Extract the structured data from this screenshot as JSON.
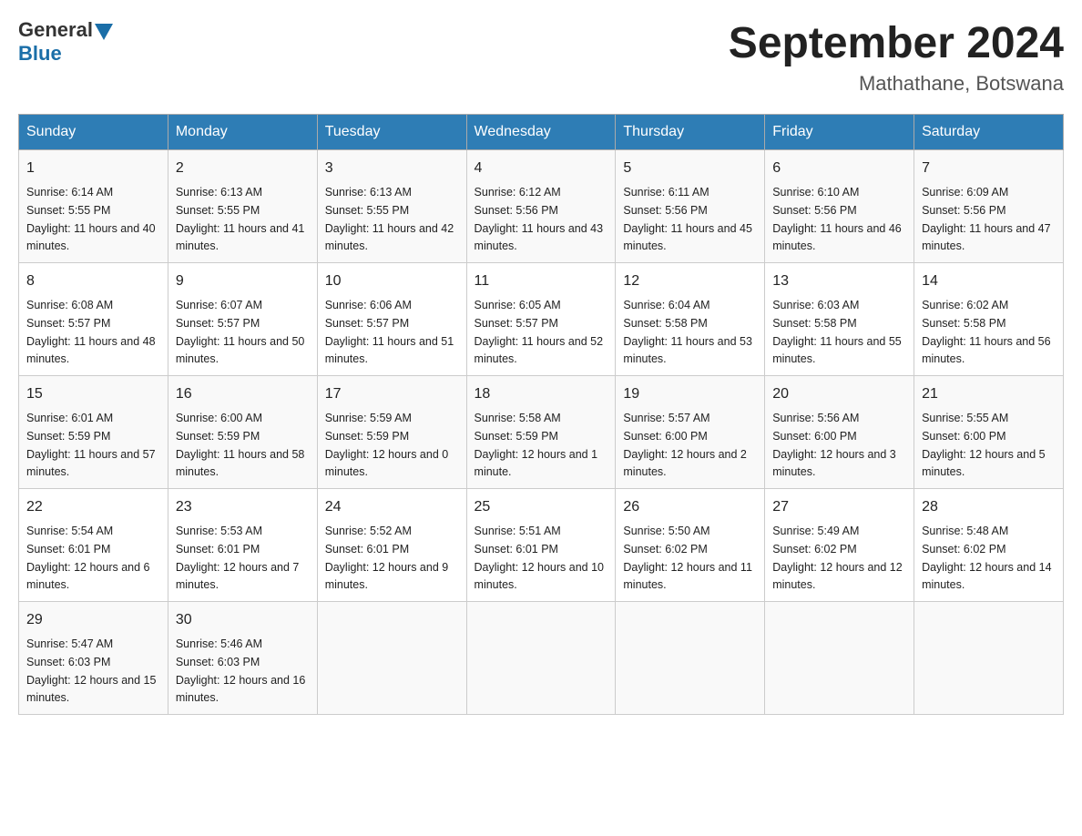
{
  "header": {
    "logo_general": "General",
    "logo_blue": "Blue",
    "month_title": "September 2024",
    "location": "Mathathane, Botswana"
  },
  "days_of_week": [
    "Sunday",
    "Monday",
    "Tuesday",
    "Wednesday",
    "Thursday",
    "Friday",
    "Saturday"
  ],
  "weeks": [
    [
      {
        "day": "1",
        "sunrise": "Sunrise: 6:14 AM",
        "sunset": "Sunset: 5:55 PM",
        "daylight": "Daylight: 11 hours and 40 minutes."
      },
      {
        "day": "2",
        "sunrise": "Sunrise: 6:13 AM",
        "sunset": "Sunset: 5:55 PM",
        "daylight": "Daylight: 11 hours and 41 minutes."
      },
      {
        "day": "3",
        "sunrise": "Sunrise: 6:13 AM",
        "sunset": "Sunset: 5:55 PM",
        "daylight": "Daylight: 11 hours and 42 minutes."
      },
      {
        "day": "4",
        "sunrise": "Sunrise: 6:12 AM",
        "sunset": "Sunset: 5:56 PM",
        "daylight": "Daylight: 11 hours and 43 minutes."
      },
      {
        "day": "5",
        "sunrise": "Sunrise: 6:11 AM",
        "sunset": "Sunset: 5:56 PM",
        "daylight": "Daylight: 11 hours and 45 minutes."
      },
      {
        "day": "6",
        "sunrise": "Sunrise: 6:10 AM",
        "sunset": "Sunset: 5:56 PM",
        "daylight": "Daylight: 11 hours and 46 minutes."
      },
      {
        "day": "7",
        "sunrise": "Sunrise: 6:09 AM",
        "sunset": "Sunset: 5:56 PM",
        "daylight": "Daylight: 11 hours and 47 minutes."
      }
    ],
    [
      {
        "day": "8",
        "sunrise": "Sunrise: 6:08 AM",
        "sunset": "Sunset: 5:57 PM",
        "daylight": "Daylight: 11 hours and 48 minutes."
      },
      {
        "day": "9",
        "sunrise": "Sunrise: 6:07 AM",
        "sunset": "Sunset: 5:57 PM",
        "daylight": "Daylight: 11 hours and 50 minutes."
      },
      {
        "day": "10",
        "sunrise": "Sunrise: 6:06 AM",
        "sunset": "Sunset: 5:57 PM",
        "daylight": "Daylight: 11 hours and 51 minutes."
      },
      {
        "day": "11",
        "sunrise": "Sunrise: 6:05 AM",
        "sunset": "Sunset: 5:57 PM",
        "daylight": "Daylight: 11 hours and 52 minutes."
      },
      {
        "day": "12",
        "sunrise": "Sunrise: 6:04 AM",
        "sunset": "Sunset: 5:58 PM",
        "daylight": "Daylight: 11 hours and 53 minutes."
      },
      {
        "day": "13",
        "sunrise": "Sunrise: 6:03 AM",
        "sunset": "Sunset: 5:58 PM",
        "daylight": "Daylight: 11 hours and 55 minutes."
      },
      {
        "day": "14",
        "sunrise": "Sunrise: 6:02 AM",
        "sunset": "Sunset: 5:58 PM",
        "daylight": "Daylight: 11 hours and 56 minutes."
      }
    ],
    [
      {
        "day": "15",
        "sunrise": "Sunrise: 6:01 AM",
        "sunset": "Sunset: 5:59 PM",
        "daylight": "Daylight: 11 hours and 57 minutes."
      },
      {
        "day": "16",
        "sunrise": "Sunrise: 6:00 AM",
        "sunset": "Sunset: 5:59 PM",
        "daylight": "Daylight: 11 hours and 58 minutes."
      },
      {
        "day": "17",
        "sunrise": "Sunrise: 5:59 AM",
        "sunset": "Sunset: 5:59 PM",
        "daylight": "Daylight: 12 hours and 0 minutes."
      },
      {
        "day": "18",
        "sunrise": "Sunrise: 5:58 AM",
        "sunset": "Sunset: 5:59 PM",
        "daylight": "Daylight: 12 hours and 1 minute."
      },
      {
        "day": "19",
        "sunrise": "Sunrise: 5:57 AM",
        "sunset": "Sunset: 6:00 PM",
        "daylight": "Daylight: 12 hours and 2 minutes."
      },
      {
        "day": "20",
        "sunrise": "Sunrise: 5:56 AM",
        "sunset": "Sunset: 6:00 PM",
        "daylight": "Daylight: 12 hours and 3 minutes."
      },
      {
        "day": "21",
        "sunrise": "Sunrise: 5:55 AM",
        "sunset": "Sunset: 6:00 PM",
        "daylight": "Daylight: 12 hours and 5 minutes."
      }
    ],
    [
      {
        "day": "22",
        "sunrise": "Sunrise: 5:54 AM",
        "sunset": "Sunset: 6:01 PM",
        "daylight": "Daylight: 12 hours and 6 minutes."
      },
      {
        "day": "23",
        "sunrise": "Sunrise: 5:53 AM",
        "sunset": "Sunset: 6:01 PM",
        "daylight": "Daylight: 12 hours and 7 minutes."
      },
      {
        "day": "24",
        "sunrise": "Sunrise: 5:52 AM",
        "sunset": "Sunset: 6:01 PM",
        "daylight": "Daylight: 12 hours and 9 minutes."
      },
      {
        "day": "25",
        "sunrise": "Sunrise: 5:51 AM",
        "sunset": "Sunset: 6:01 PM",
        "daylight": "Daylight: 12 hours and 10 minutes."
      },
      {
        "day": "26",
        "sunrise": "Sunrise: 5:50 AM",
        "sunset": "Sunset: 6:02 PM",
        "daylight": "Daylight: 12 hours and 11 minutes."
      },
      {
        "day": "27",
        "sunrise": "Sunrise: 5:49 AM",
        "sunset": "Sunset: 6:02 PM",
        "daylight": "Daylight: 12 hours and 12 minutes."
      },
      {
        "day": "28",
        "sunrise": "Sunrise: 5:48 AM",
        "sunset": "Sunset: 6:02 PM",
        "daylight": "Daylight: 12 hours and 14 minutes."
      }
    ],
    [
      {
        "day": "29",
        "sunrise": "Sunrise: 5:47 AM",
        "sunset": "Sunset: 6:03 PM",
        "daylight": "Daylight: 12 hours and 15 minutes."
      },
      {
        "day": "30",
        "sunrise": "Sunrise: 5:46 AM",
        "sunset": "Sunset: 6:03 PM",
        "daylight": "Daylight: 12 hours and 16 minutes."
      },
      null,
      null,
      null,
      null,
      null
    ]
  ]
}
